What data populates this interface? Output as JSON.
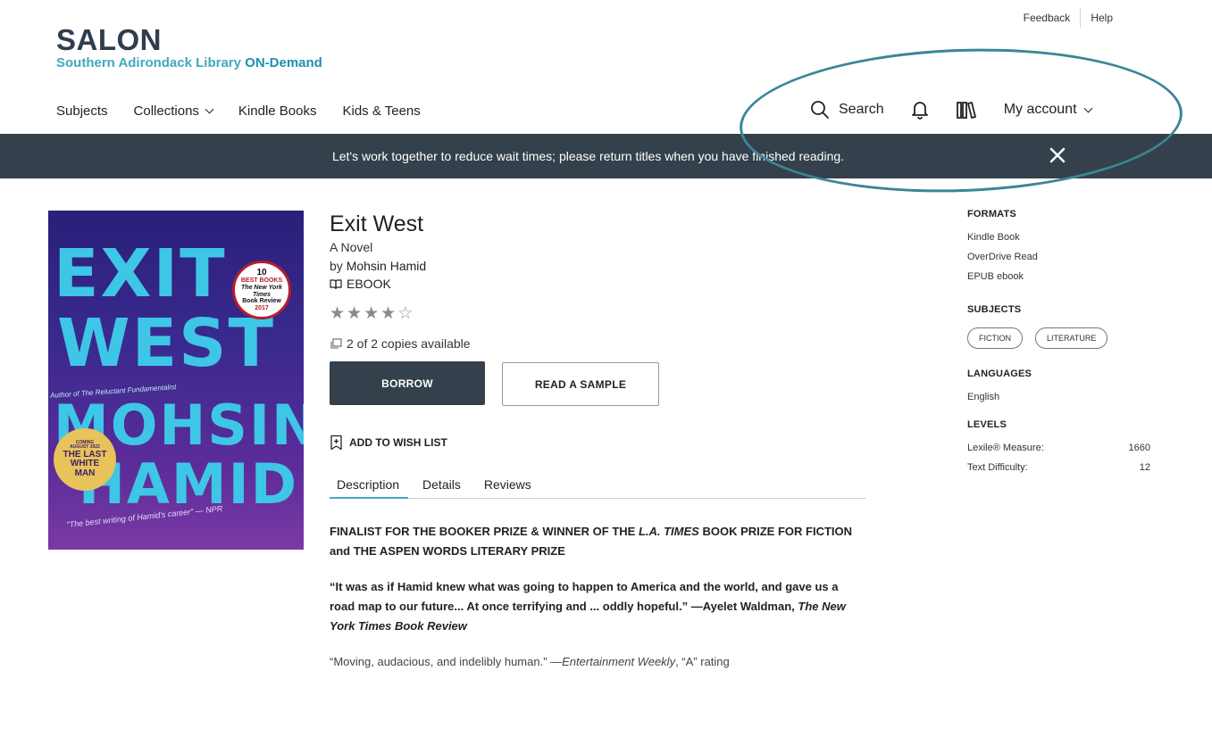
{
  "util": {
    "feedback": "Feedback",
    "help": "Help"
  },
  "logo": {
    "main": "SALON",
    "sub": "Southern Adirondack Library",
    "sub_bold": "ON-Demand"
  },
  "nav": {
    "subjects": "Subjects",
    "collections": "Collections",
    "kindle": "Kindle Books",
    "kids": "Kids & Teens"
  },
  "actions": {
    "search": "Search",
    "account": "My account"
  },
  "banner": {
    "text": "Let's work together to reduce wait times; please return titles when you have finished reading."
  },
  "cover": {
    "title_1": "EXIT",
    "title_2": "WEST",
    "author_1": "MOHSIN",
    "author_2": "HAMID",
    "seal": [
      "10",
      "BEST BOOKS",
      "The New York Times",
      "Book Review",
      "2017"
    ],
    "badge": [
      "COMING",
      "AUGUST 2022",
      "THE LAST",
      "WHITE",
      "MAN"
    ],
    "quote": "\"The best writing of Hamid's career\" — NPR",
    "author_line": "Author of The Reluctant Fundamentalist"
  },
  "book": {
    "title": "Exit West",
    "subtitle": "A Novel",
    "by": "by",
    "author": "Mohsin Hamid",
    "format": "EBOOK",
    "rating": 4,
    "copies": "2 of 2 copies available"
  },
  "buttons": {
    "borrow": "BORROW",
    "sample": "READ A SAMPLE",
    "wishlist": "ADD TO WISH LIST"
  },
  "tabs": [
    "Description",
    "Details",
    "Reviews"
  ],
  "description": {
    "p1_a": "FINALIST FOR THE BOOKER PRIZE & WINNER OF THE ",
    "p1_italic": "L.A. TIMES",
    "p1_b": " BOOK PRIZE FOR FICTION and THE ASPEN WORDS LITERARY PRIZE",
    "p2_a": "“It was as if Hamid knew what was going to happen to America and the world, and gave us a road map to our future... At once terrifying and ... oddly hopeful.” —Ayelet Waldman, ",
    "p2_italic": "The New York Times Book Review",
    "p3_a": "“Moving, audacious, and indelibly human.” —",
    "p3_italic": "Entertainment Weekly",
    "p3_b": ", “A” rating"
  },
  "sidebar": {
    "formats_head": "FORMATS",
    "formats": [
      "Kindle Book",
      "OverDrive Read",
      "EPUB ebook"
    ],
    "subjects_head": "SUBJECTS",
    "subjects": [
      "FICTION",
      "LITERATURE"
    ],
    "languages_head": "LANGUAGES",
    "languages": [
      "English"
    ],
    "levels_head": "LEVELS",
    "levels": [
      {
        "label": "Lexile® Measure:",
        "value": "1660"
      },
      {
        "label": "Text Difficulty:",
        "value": "12"
      }
    ]
  },
  "colors": {
    "brand_dark": "#34404c",
    "brand_accent": "#3fa9c1",
    "annotation": "#3a8796"
  }
}
